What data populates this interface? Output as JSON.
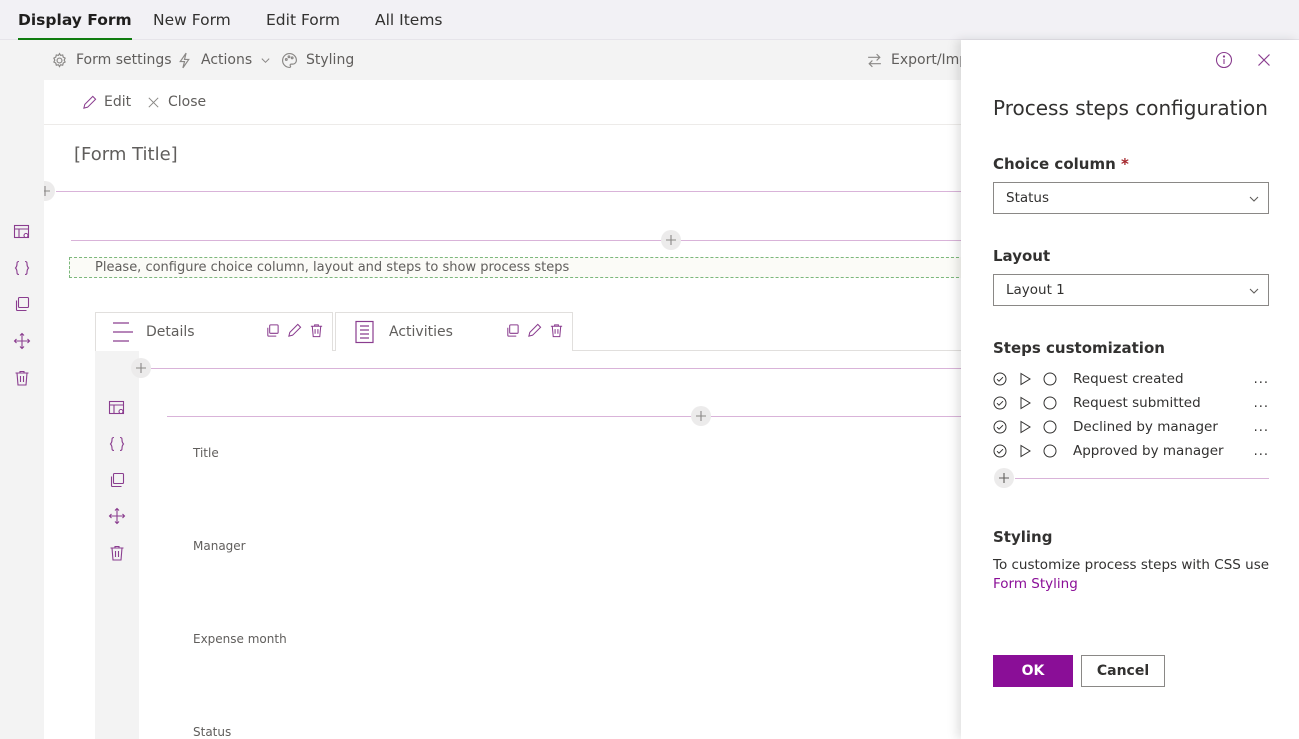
{
  "tabs": [
    "Display Form",
    "New Form",
    "Edit Form",
    "All Items"
  ],
  "toolbar": {
    "form_settings": "Form settings",
    "actions": "Actions",
    "styling": "Styling",
    "export": "Export/Impo"
  },
  "commands": {
    "edit": "Edit",
    "close": "Close"
  },
  "form": {
    "title": "[Form Title]",
    "placeholder": "Please, configure choice column, layout and steps to show process steps",
    "tabs": [
      "Details",
      "Activities"
    ],
    "fields": [
      "Title",
      "Manager",
      "Expense month",
      "Status"
    ]
  },
  "panel": {
    "title": "Process steps configuration",
    "choice_label": "Choice column",
    "required_mark": "*",
    "choice_value": "Status",
    "layout_label": "Layout",
    "layout_value": "Layout 1",
    "steps_label": "Steps customization",
    "steps": [
      "Request created",
      "Request submitted",
      "Declined by manager",
      "Approved by manager"
    ],
    "more": "...",
    "styling_label": "Styling",
    "styling_desc": "To customize process steps with CSS use",
    "styling_link": "Form Styling",
    "ok": "OK",
    "cancel": "Cancel"
  },
  "colors": {
    "accent": "#8a0e97",
    "tab_underline": "#107c10",
    "divider": "#d9b3d9",
    "icon_purple": "#8a3d8f"
  },
  "icons": [
    "gear-icon",
    "lightning-icon",
    "chevron-down-icon",
    "palette-icon",
    "swap-arrows-icon",
    "info-icon",
    "close-icon",
    "pencil-icon",
    "plus-icon",
    "table-icon",
    "braces-icon",
    "copy-icon",
    "move-icon",
    "trash-icon",
    "check-circle-icon",
    "play-icon",
    "circle-icon",
    "lines-icon",
    "list-doc-icon"
  ]
}
